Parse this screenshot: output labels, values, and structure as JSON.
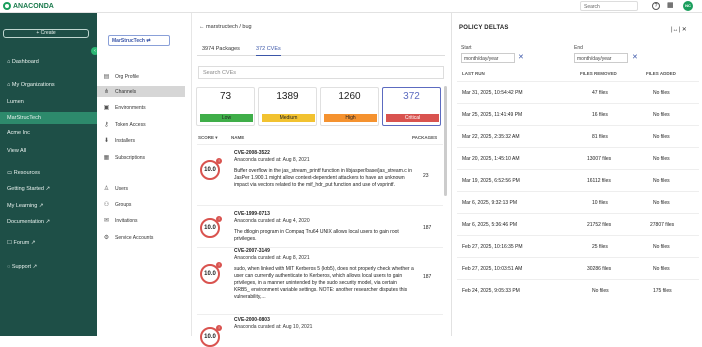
{
  "app": {
    "brand": "ANACONDA",
    "search_placeholder": "Search",
    "avatar_initials": "NC"
  },
  "sidebar": {
    "create": "+ Create",
    "items": [
      {
        "label": "Dashboard",
        "icon": "home-icon"
      },
      {
        "label": "My Organizations",
        "icon": "org-icon"
      },
      {
        "label": "Lumen"
      },
      {
        "label": "MarStrucTech",
        "selected": true
      },
      {
        "label": "Acme Inc"
      },
      {
        "label": "View All"
      },
      {
        "label": "Resources",
        "icon": "book-icon"
      },
      {
        "label": "Getting Started"
      },
      {
        "label": "My Learning"
      },
      {
        "label": "Documentation"
      },
      {
        "label": "Forum"
      },
      {
        "label": "Support"
      }
    ]
  },
  "org": {
    "channel_button": "MarStrucTech",
    "items": [
      {
        "label": "Org Profile",
        "icon": "profile-icon"
      },
      {
        "label": "Channels",
        "icon": "channels-icon",
        "selected": true
      },
      {
        "label": "Environments",
        "icon": "environments-icon"
      },
      {
        "label": "Token Access",
        "icon": "key-icon"
      },
      {
        "label": "Installers",
        "icon": "installer-icon"
      },
      {
        "label": "Subscriptions",
        "icon": "subscription-icon"
      },
      {
        "label": "Users",
        "icon": "users-icon"
      },
      {
        "label": "Groups",
        "icon": "groups-icon"
      },
      {
        "label": "Invitations",
        "icon": "mail-icon"
      },
      {
        "label": "Service Accounts",
        "icon": "service-account-icon"
      }
    ]
  },
  "main": {
    "breadcrumb": "marstructech / bug",
    "tabs": [
      {
        "label": "3974 Packages"
      },
      {
        "label": "372 CVEs",
        "selected": true
      }
    ],
    "search_placeholder": "Search CVEs",
    "severity": [
      {
        "count": "73",
        "label": "Low",
        "color": "#3fae49"
      },
      {
        "count": "1389",
        "label": "Medium",
        "color": "#f2c230"
      },
      {
        "count": "1260",
        "label": "High",
        "color": "#f5922f"
      },
      {
        "count": "372",
        "label": "Critical",
        "color": "#d9534f"
      }
    ],
    "columns": {
      "score": "SCORE ▾",
      "name": "NAME",
      "packages": "PACKAGES"
    },
    "cves": [
      {
        "score": "10.0",
        "id": "CVE-2008-3522",
        "curated": "Anaconda curated at: Aug 8, 2021",
        "desc": "Buffer overflow in the jas_stream_printf function in libjasper/base/jas_stream.c in JasPer 1.900.1 might allow context-dependent attackers to have an unknown impact via vectors related to the mif_hdr_put function and use of vsprintf.",
        "packages": "23"
      },
      {
        "score": "10.0",
        "id": "CVE-1999-0713",
        "curated": "Anaconda curated at: Aug 4, 2020",
        "desc": "The dtlogin program in Compaq Tru64 UNIX allows local users to gain root privileges.",
        "packages": "187"
      },
      {
        "score": "10.0",
        "id": "CVE-2007-3149",
        "curated": "Anaconda curated at: Aug 8, 2021",
        "desc": "sudo, when linked with MIT Kerberos 5 (krb5), does not properly check whether a user can currently authenticate to Kerberos, which allows local users to gain privileges, in a manner unintended by the sudo security model, via certain KRB5_ environment variable settings. NOTE: another researcher disputes this vulnerability,...",
        "packages": "187"
      },
      {
        "score": "10.0",
        "id": "CVE-2000-0803",
        "curated": "Anaconda curated at: Aug 10, 2021",
        "desc": "",
        "packages": ""
      }
    ]
  },
  "policy": {
    "title": "POLICY DELTAS",
    "start_label": "Start",
    "end_label": "End",
    "date_placeholder": "month/day/year",
    "columns": {
      "run": "LAST RUN",
      "removed": "FILES REMOVED",
      "added": "FILES ADDED"
    },
    "rows": [
      {
        "run": "Mar 31, 2025, 10:54:42 PM",
        "removed": "47 files",
        "added": "No files"
      },
      {
        "run": "Mar 25, 2025, 11:41:49 PM",
        "removed": "16 files",
        "added": "No files"
      },
      {
        "run": "Mar 22, 2025, 2:35:32 AM",
        "removed": "81 files",
        "added": "No files"
      },
      {
        "run": "Mar 20, 2025, 1:45:10 AM",
        "removed": "13007 files",
        "added": "No files"
      },
      {
        "run": "Mar 19, 2025, 6:52:56 PM",
        "removed": "16112 files",
        "added": "No files"
      },
      {
        "run": "Mar 6, 2025, 9:32:13 PM",
        "removed": "10 files",
        "added": "No files"
      },
      {
        "run": "Mar 6, 2025, 5:36:46 PM",
        "removed": "21752 files",
        "added": "27807 files"
      },
      {
        "run": "Feb 27, 2025, 10:16:35 PM",
        "removed": "25 files",
        "added": "No files"
      },
      {
        "run": "Feb 27, 2025, 10:03:51 AM",
        "removed": "30286 files",
        "added": "No files"
      },
      {
        "run": "Feb 24, 2025, 9:05:33 PM",
        "removed": "No files",
        "added": "175 files"
      }
    ]
  }
}
